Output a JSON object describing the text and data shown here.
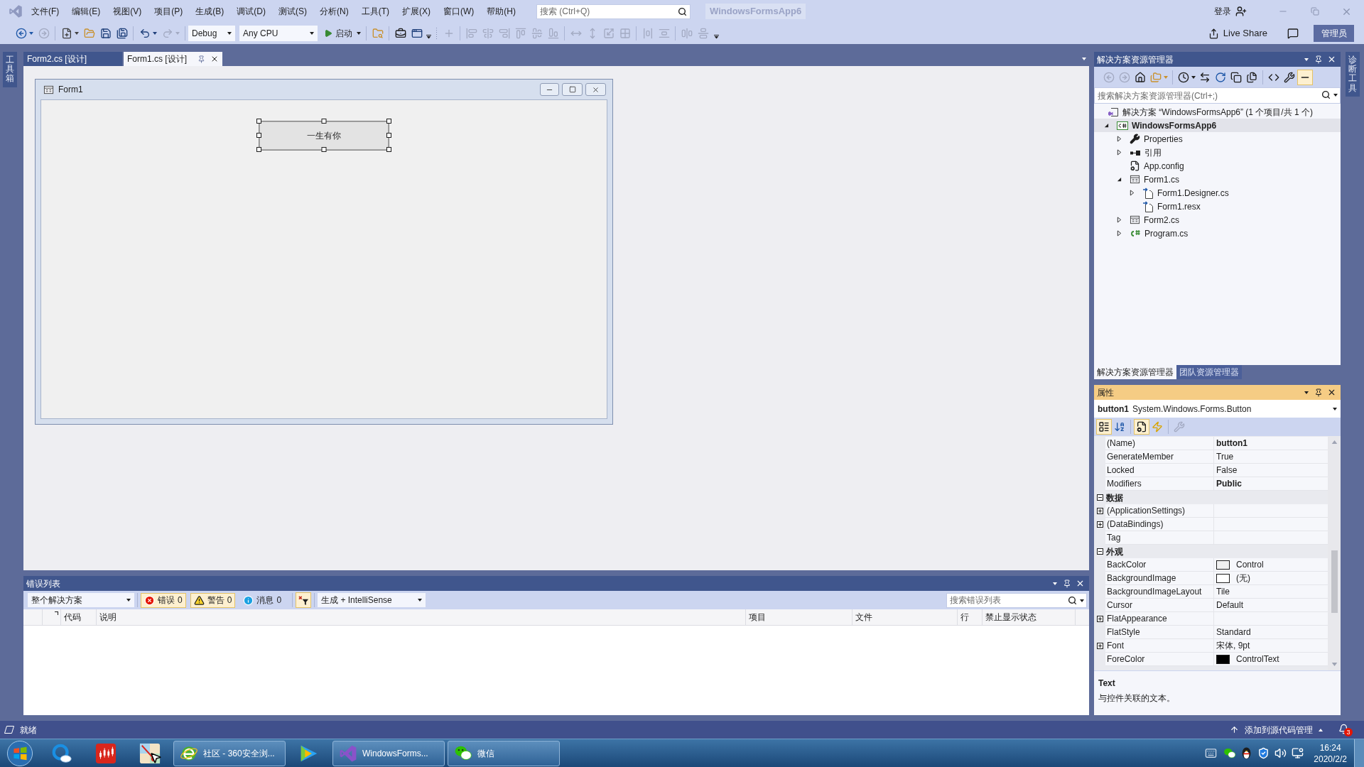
{
  "menu_bar": {
    "items": [
      "文件(F)",
      "编辑(E)",
      "视图(V)",
      "项目(P)",
      "生成(B)",
      "调试(D)",
      "测试(S)",
      "分析(N)",
      "工具(T)",
      "扩展(X)",
      "窗口(W)",
      "帮助(H)"
    ],
    "search": {
      "placeholder": "搜索 (Ctrl+Q)"
    },
    "solution_name": "WindowsFormsApp6",
    "sign_in": "登录"
  },
  "toolbar": {
    "navigation": [
      {
        "kind": "back",
        "disabled": false
      },
      {
        "kind": "forward",
        "disabled": true
      }
    ],
    "file": [
      {
        "kind": "new",
        "disabled": false
      },
      {
        "kind": "open",
        "disabled": false
      },
      {
        "kind": "save",
        "disabled": false
      },
      {
        "kind": "save_all",
        "disabled": false
      }
    ],
    "history": [
      {
        "kind": "undo",
        "disabled": false
      },
      {
        "kind": "redo",
        "disabled": true
      }
    ],
    "configuration": "Debug",
    "platform": "Any CPU",
    "start": "启动",
    "tools": [
      {
        "kind": "find",
        "disabled": false
      },
      {
        "kind": "toolbox",
        "disabled": false
      },
      {
        "kind": "window",
        "disabled": false
      }
    ],
    "layout": [
      [
        {
          "kind": "align_grid",
          "disabled": true
        }
      ],
      [
        {
          "kind": "align_left",
          "disabled": true
        },
        {
          "kind": "align_center",
          "disabled": true
        },
        {
          "kind": "align_right",
          "disabled": true
        },
        {
          "kind": "align_top",
          "disabled": true
        },
        {
          "kind": "align_middle",
          "disabled": true
        },
        {
          "kind": "align_bottom",
          "disabled": true
        }
      ],
      [
        {
          "kind": "same_width",
          "disabled": true
        },
        {
          "kind": "same_height",
          "disabled": true
        },
        {
          "kind": "same_size",
          "disabled": true
        },
        {
          "kind": "size_to_grid",
          "disabled": true
        }
      ],
      [
        {
          "kind": "h_spacing",
          "disabled": true
        },
        {
          "kind": "v_spacing",
          "disabled": true
        }
      ],
      [
        {
          "kind": "center_h",
          "disabled": true
        },
        {
          "kind": "center_v",
          "disabled": true
        }
      ]
    ],
    "live_share": "Live Share",
    "role_badge": "管理员"
  },
  "side_rails": {
    "left": "工具箱",
    "right": "诊断工具"
  },
  "document_tabs": [
    {
      "label": "Form2.cs [设计]",
      "selected": false
    },
    {
      "label": "Form1.cs [设计]",
      "selected": true
    }
  ],
  "designer": {
    "form_title": "Form1",
    "button": {
      "text": "一生有你",
      "selected": true
    }
  },
  "solution_explorer": {
    "title": "解决方案资源管理器",
    "active": false,
    "toolbar": [
      {
        "kind": "back",
        "disabled": true,
        "selected": false
      },
      {
        "kind": "forward",
        "disabled": true,
        "selected": false
      },
      {
        "kind": "home",
        "disabled": false,
        "selected": false
      },
      {
        "kind": "views",
        "disabled": false,
        "selected": false
      },
      {
        "kind": "pending",
        "disabled": false,
        "selected": false
      },
      {
        "kind": "sync",
        "disabled": false,
        "selected": false
      },
      {
        "kind": "refresh",
        "disabled": false,
        "selected": false
      },
      {
        "kind": "collapse",
        "disabled": false,
        "selected": false
      },
      {
        "kind": "show_all",
        "disabled": false,
        "selected": false
      },
      {
        "kind": "code",
        "disabled": false,
        "selected": false
      },
      {
        "kind": "properties",
        "disabled": false,
        "selected": false
      },
      {
        "kind": "preview",
        "disabled": false,
        "selected": true
      }
    ],
    "search": {
      "placeholder": "搜索解决方案资源管理器(Ctrl+;)"
    },
    "tree": [
      {
        "label": "解决方案 “WindowsFormsApp6” (1 个项目/共 1 个)",
        "kind": "solution",
        "selected": false,
        "children": [
          {
            "label": "WindowsFormsApp6",
            "kind": "project",
            "selected": true,
            "expanded": true,
            "children": [
              {
                "label": "Properties",
                "kind": "properties",
                "selected": false,
                "expanded": false
              },
              {
                "label": "引用",
                "kind": "references",
                "selected": false,
                "expanded": false
              },
              {
                "label": "App.config",
                "kind": "config",
                "selected": false
              },
              {
                "label": "Form1.cs",
                "kind": "form",
                "selected": false,
                "expanded": true,
                "children": [
                  {
                    "label": "Form1.Designer.cs",
                    "kind": "generated",
                    "selected": false,
                    "expanded": false
                  },
                  {
                    "label": "Form1.resx",
                    "kind": "generated",
                    "selected": false
                  }
                ]
              },
              {
                "label": "Form2.cs",
                "kind": "form",
                "selected": false,
                "expanded": false
              },
              {
                "label": "Program.cs",
                "kind": "csharp",
                "selected": false,
                "expanded": false
              }
            ]
          }
        ]
      }
    ],
    "tabs": [
      {
        "label": "解决方案资源管理器",
        "selected": true
      },
      {
        "label": "团队资源管理器",
        "selected": false
      }
    ]
  },
  "properties": {
    "title": "属性",
    "active": true,
    "object": {
      "name": "button1",
      "type": "System.Windows.Forms.Button"
    },
    "toolbar": [
      {
        "kind": "categorized",
        "selected": true,
        "disabled": false
      },
      {
        "kind": "alphabetical",
        "selected": false,
        "disabled": false
      },
      {
        "kind": "properties",
        "selected": true,
        "disabled": false
      },
      {
        "kind": "events",
        "selected": false,
        "disabled": false
      },
      {
        "kind": "pages",
        "selected": false,
        "disabled": true
      }
    ],
    "rows": [
      {
        "kind": "property",
        "name": "(Name)",
        "value": "button1",
        "modified": true
      },
      {
        "kind": "property",
        "name": "GenerateMember",
        "value": "True",
        "modified": false
      },
      {
        "kind": "property",
        "name": "Locked",
        "value": "False",
        "modified": false
      },
      {
        "kind": "property",
        "name": "Modifiers",
        "value": "Public",
        "modified": true
      },
      {
        "kind": "category",
        "name": "数据",
        "expanded": true
      },
      {
        "kind": "property",
        "name": "(ApplicationSettings)",
        "expanded": false
      },
      {
        "kind": "property",
        "name": "(DataBindings)",
        "expanded": false
      },
      {
        "kind": "property",
        "name": "Tag"
      },
      {
        "kind": "category",
        "name": "外观",
        "expanded": true
      },
      {
        "kind": "property",
        "name": "BackColor",
        "value": "Control",
        "color": "#f0f0f0",
        "modified": false
      },
      {
        "kind": "property",
        "name": "BackgroundImage",
        "value": "(无)",
        "color": "#ffffff",
        "modified": false
      },
      {
        "kind": "property",
        "name": "BackgroundImageLayout",
        "value": "Tile",
        "modified": false
      },
      {
        "kind": "property",
        "name": "Cursor",
        "value": "Default",
        "modified": false
      },
      {
        "kind": "property",
        "name": "FlatAppearance",
        "expanded": false
      },
      {
        "kind": "property",
        "name": "FlatStyle",
        "value": "Standard",
        "modified": false
      },
      {
        "kind": "property",
        "name": "Font",
        "value": "宋体, 9pt",
        "expanded": false,
        "modified": false
      },
      {
        "kind": "property",
        "name": "ForeColor",
        "value": "ControlText",
        "color": "#000000",
        "modified": false
      }
    ],
    "description": {
      "title": "Text",
      "text": "与控件关联的文本。"
    }
  },
  "error_list": {
    "title": "错误列表",
    "active": false,
    "scope": "整个解决方案",
    "filters": [
      {
        "kind": "error",
        "label": "错误",
        "count": "0",
        "selected": true
      },
      {
        "kind": "warning",
        "label": "警告",
        "count": "0",
        "selected": true
      },
      {
        "kind": "message",
        "label": "消息",
        "count": "0",
        "selected": false
      }
    ],
    "filter_toggle": {
      "selected": true
    },
    "source": "生成 + IntelliSense",
    "search": {
      "placeholder": "搜索错误列表"
    },
    "columns": [
      "代码",
      "说明",
      "项目",
      "文件",
      "行",
      "禁止显示状态"
    ]
  },
  "status_bar": {
    "text": "就绪",
    "source_control": "添加到源代码管理",
    "notifications": "3"
  },
  "taskbar": {
    "items": [
      {
        "kind": "cloud"
      },
      {
        "kind": "stocks"
      },
      {
        "kind": "paint"
      },
      {
        "kind": "browser",
        "label": "社区 - 360安全浏..."
      },
      {
        "kind": "video"
      },
      {
        "kind": "studio",
        "label": "WindowsForms..."
      },
      {
        "kind": "chat",
        "label": "微信"
      }
    ],
    "clock": {
      "time": "16:24",
      "date": "2020/2/2"
    }
  }
}
